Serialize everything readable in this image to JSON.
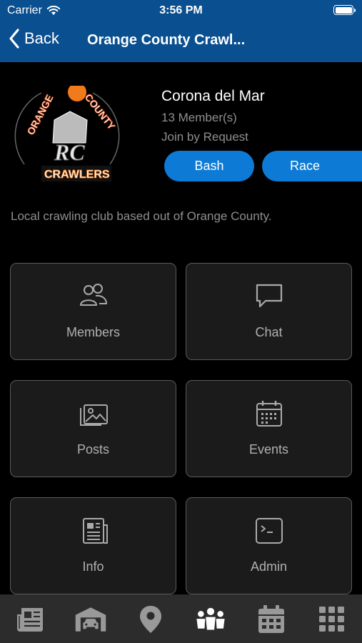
{
  "status_bar": {
    "carrier": "Carrier",
    "time": "3:56 PM"
  },
  "nav": {
    "back_label": "Back",
    "title": "Orange County Crawl..."
  },
  "club": {
    "logo_text": [
      "ORANGE",
      "COUNTY",
      "RC",
      "CRAWLERS"
    ],
    "name": "Corona del Mar",
    "members": "13 Member(s)",
    "join_type": "Join by Request",
    "tags": [
      "Bash",
      "Race"
    ],
    "description": "Local crawling club based out of Orange County."
  },
  "tiles": [
    {
      "label": "Members",
      "icon": "members-icon"
    },
    {
      "label": "Chat",
      "icon": "chat-icon"
    },
    {
      "label": "Posts",
      "icon": "posts-icon"
    },
    {
      "label": "Events",
      "icon": "events-icon"
    },
    {
      "label": "Info",
      "icon": "info-icon"
    },
    {
      "label": "Admin",
      "icon": "admin-icon"
    }
  ],
  "tabbar": {
    "items": [
      "news-icon",
      "garage-icon",
      "location-icon",
      "clubs-icon",
      "calendar-icon",
      "grid-menu-icon"
    ],
    "active": "clubs-icon"
  },
  "colors": {
    "header": "#0a4f8f",
    "accent": "#0d7bd6",
    "tile_bg": "#1b1b1b",
    "tabbar_bg": "#2c2c2c"
  }
}
